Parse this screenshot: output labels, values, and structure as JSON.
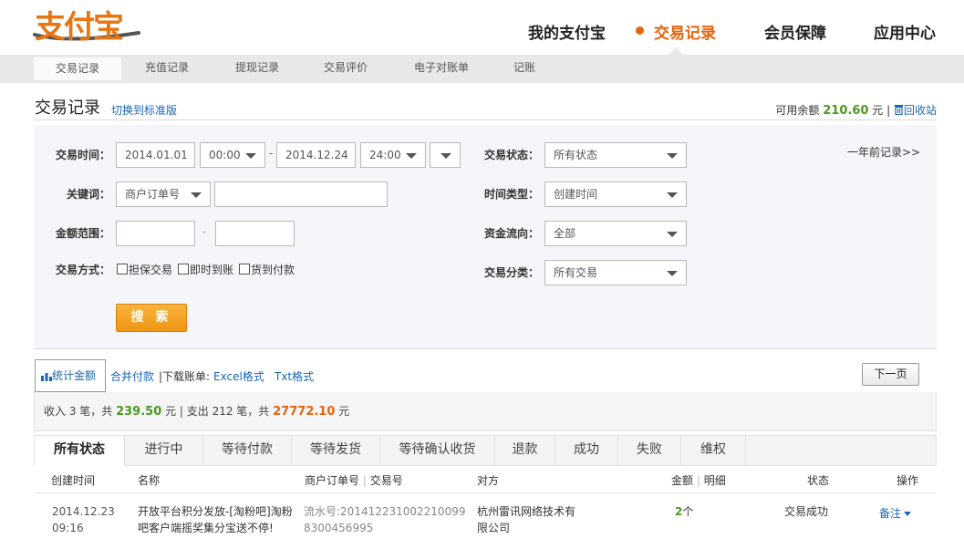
{
  "logo": {
    "text": "支付宝"
  },
  "topnav": {
    "items": [
      "我的支付宝",
      "交易记录",
      "会员保障",
      "应用中心"
    ],
    "active": "交易记录"
  },
  "subnav": {
    "items": [
      "交易记录",
      "充值记录",
      "提现记录",
      "交易评价",
      "电子对账单",
      "记账"
    ],
    "active": "交易记录"
  },
  "page": {
    "title": "交易记录",
    "switch_link": "切换到标准版",
    "balance_label": "可用余额",
    "balance_amount": "210.60",
    "balance_unit": "元",
    "separator": "|",
    "recycle_bin": "回收站"
  },
  "search": {
    "time_label": "交易时间：",
    "start_date": "2014.01.01",
    "start_time": "00:00",
    "date_dash": "-",
    "end_date": "2014.12.24",
    "end_time": "24:00",
    "keyword_label": "关键词：",
    "keyword_type": "商户订单号",
    "keyword_value": "",
    "amount_label": "金额范围：",
    "amount_min": "",
    "amount_dash": "-",
    "amount_max": "",
    "method_label": "交易方式：",
    "methods": [
      "担保交易",
      "即时到账",
      "货到付款"
    ],
    "status_label": "交易状态：",
    "status_value": "所有状态",
    "timetype_label": "时间类型：",
    "timetype_value": "创建时间",
    "flow_label": "资金流向：",
    "flow_value": "全部",
    "category_label": "交易分类：",
    "category_value": "所有交易",
    "search_button": "搜 索",
    "older_link": "一年前记录>>"
  },
  "toolbar": {
    "stat_button": "统计金额",
    "merge_pay": "合并付款",
    "download_label": "|下载账单:",
    "excel": "Excel格式",
    "txt": "Txt格式",
    "next_page": "下一页"
  },
  "summary": {
    "income_prefix": "收入 3 笔，共",
    "income_amount": "239.50",
    "income_suffix": "元 | 支出 212 笔，共",
    "expense_amount": "27772.10",
    "expense_suffix": "元"
  },
  "status_tabs": [
    "所有状态",
    "进行中",
    "等待付款",
    "等待发货",
    "等待确认收货",
    "退款",
    "成功",
    "失败",
    "维权"
  ],
  "table": {
    "headers": {
      "time": "创建时间",
      "name": "名称",
      "order": "商户订单号",
      "serial": "交易号",
      "party": "对方",
      "amount": "金额",
      "detail": "明细",
      "status": "状态",
      "op": "操作"
    },
    "rows": [
      {
        "date": "2014.12.23",
        "time": "09:16",
        "name": "开放平台积分发放-[淘粉吧]淘粉吧客户端摇奖集分宝送不停!",
        "order": "流水号:2014122310022100998300456995",
        "party": "杭州雷讯网络技术有限公司",
        "amount_num": "2",
        "amount_unit": "个",
        "status": "交易成功",
        "op": "备注"
      }
    ]
  },
  "colors": {
    "accent": "#e4640c",
    "link": "#1a66b3",
    "income": "#4b9a1e"
  }
}
